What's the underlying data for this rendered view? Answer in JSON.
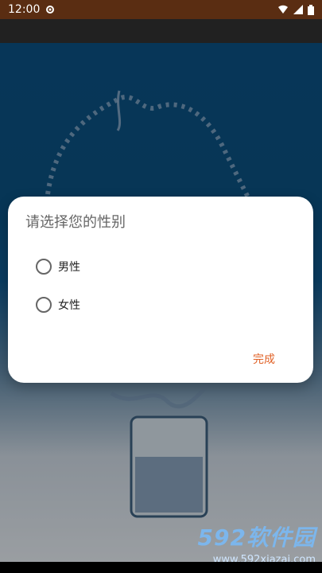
{
  "status_bar": {
    "time": "12:00"
  },
  "dialog": {
    "title": "请选择您的性别",
    "options": [
      {
        "label": "男性",
        "selected": false
      },
      {
        "label": "女性",
        "selected": false
      }
    ],
    "confirm_label": "完成"
  },
  "watermark": {
    "logo": "592软件园",
    "url": "www.592xiazai.com"
  },
  "colors": {
    "status_bar_bg": "#5a2d12",
    "accent": "#e06025",
    "background_top": "#0b4b7a"
  }
}
